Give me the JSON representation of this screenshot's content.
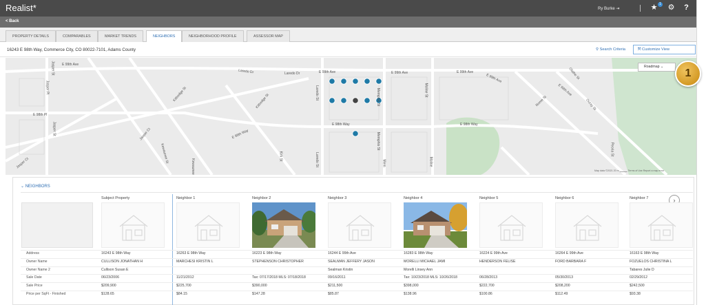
{
  "app": {
    "title": "Realist",
    "title_mark": "*",
    "user_name": "Ry Burke"
  },
  "toolbar": {
    "logout_icon": "logout-icon",
    "notify_count": "1",
    "star_icon": "star-icon",
    "gear_icon": "gear-icon",
    "help_icon": "help-icon"
  },
  "nav": {
    "back_label": "< Back"
  },
  "tabs": [
    {
      "label": "Property Details"
    },
    {
      "label": "Comparables"
    },
    {
      "label": "Market Trends"
    },
    {
      "label": "Neighbors",
      "active": true
    },
    {
      "label": "Neighborhood Profile"
    },
    {
      "label": "Assessor Map"
    }
  ],
  "property": {
    "address": "16243 E 98th Way, Commerce City, CO 80022-7101, Adams County",
    "search_criteria_label": "Search Criteria",
    "customize_view_label": "Customize View"
  },
  "map": {
    "roadmap_label": "Roadmap",
    "callout_number": "1",
    "credit": "Map data ©2021   20 m ▁▁▁▁   Terms of Use   Report a map error",
    "street_labels": [
      "E 99th Ave",
      "Laredo Dr",
      "Laredo Dr",
      "E 99th Ave",
      "E 99th Ave",
      "E 99th Ave",
      "E 99th Ave",
      "E 98th Way",
      "E 98th Way",
      "E 98th Pl",
      "E 98th Way",
      "Laredo St",
      "Laredo St",
      "Memphis St",
      "Memphis St",
      "Moline St",
      "Jasper St",
      "Jasper Pl",
      "Kittredge St",
      "Kittredge St",
      "Kirk St",
      "Jasper St",
      "Jasper Ct",
      "Kewaunee St",
      "Nome St",
      "Olathe St",
      "Peoria St",
      "Ouray St",
      "E 98th Ave",
      "Jasper Ct",
      "Kewaunee",
      "Mem",
      "Moline"
    ]
  },
  "neighbors": {
    "section_title": "Neighbors",
    "columns": [
      {
        "title": "Subject Property",
        "photo": false
      },
      {
        "title": "Neighbor 1",
        "photo": false
      },
      {
        "title": "Neighbor 2",
        "photo": true
      },
      {
        "title": "Neighbor 3",
        "photo": false
      },
      {
        "title": "Neighbor 4",
        "photo": true
      },
      {
        "title": "Neighbor 5",
        "photo": false
      },
      {
        "title": "Neighbor 6",
        "photo": false
      },
      {
        "title": "Neighbor 7",
        "photo": false
      }
    ],
    "row_labels": [
      "Address",
      "Owner Name",
      "Owner Name 2",
      "Sale Date",
      "Sale Price",
      "Price per SqFt - Finished"
    ],
    "rows": [
      [
        "16243 E 98th Way",
        "16263 E 98th Way",
        "16223 E 98th Way",
        "16244 E 99th Ave",
        "16283 E 98th Way",
        "16224 E 99th Ave",
        "16264 E 99th Ave",
        "16163 E 98th Way"
      ],
      [
        "CULLISON JONATHAN H",
        "MARCHESI KRISTIN L",
        "STEPHENSON CHRISTOPHER",
        "SEALMAN JEFFERY JASON",
        "MORELLI MICHAEL JAMI",
        "HENDERSON FELISE",
        "FORD BARBARA F",
        "FOZUELOS CHRISTINA L"
      ],
      [
        "Cullison Susan E",
        "",
        "",
        "Sealman Kristin",
        "Morelli Linsey Ann",
        "",
        "",
        "Tabares Julie D"
      ],
      [
        "06/23/2006",
        "11/21/2012",
        "Tax: 07/17/2018 MLS: 07/18/2018",
        "09/16/2011",
        "Tax: 10/23/2018 MLS: 10/26/2018",
        "06/28/2013",
        "05/30/2013",
        "02/29/2012"
      ],
      [
        "$209,900",
        "$225,700",
        "$390,000",
        "$211,500",
        "$398,000",
        "$222,700",
        "$208,200",
        "$242,500"
      ],
      [
        "$128.65",
        "$84.15",
        "$147.28",
        "$85.87",
        "$138.96",
        "$100.86",
        "$112.49",
        "$93.38"
      ]
    ]
  }
}
